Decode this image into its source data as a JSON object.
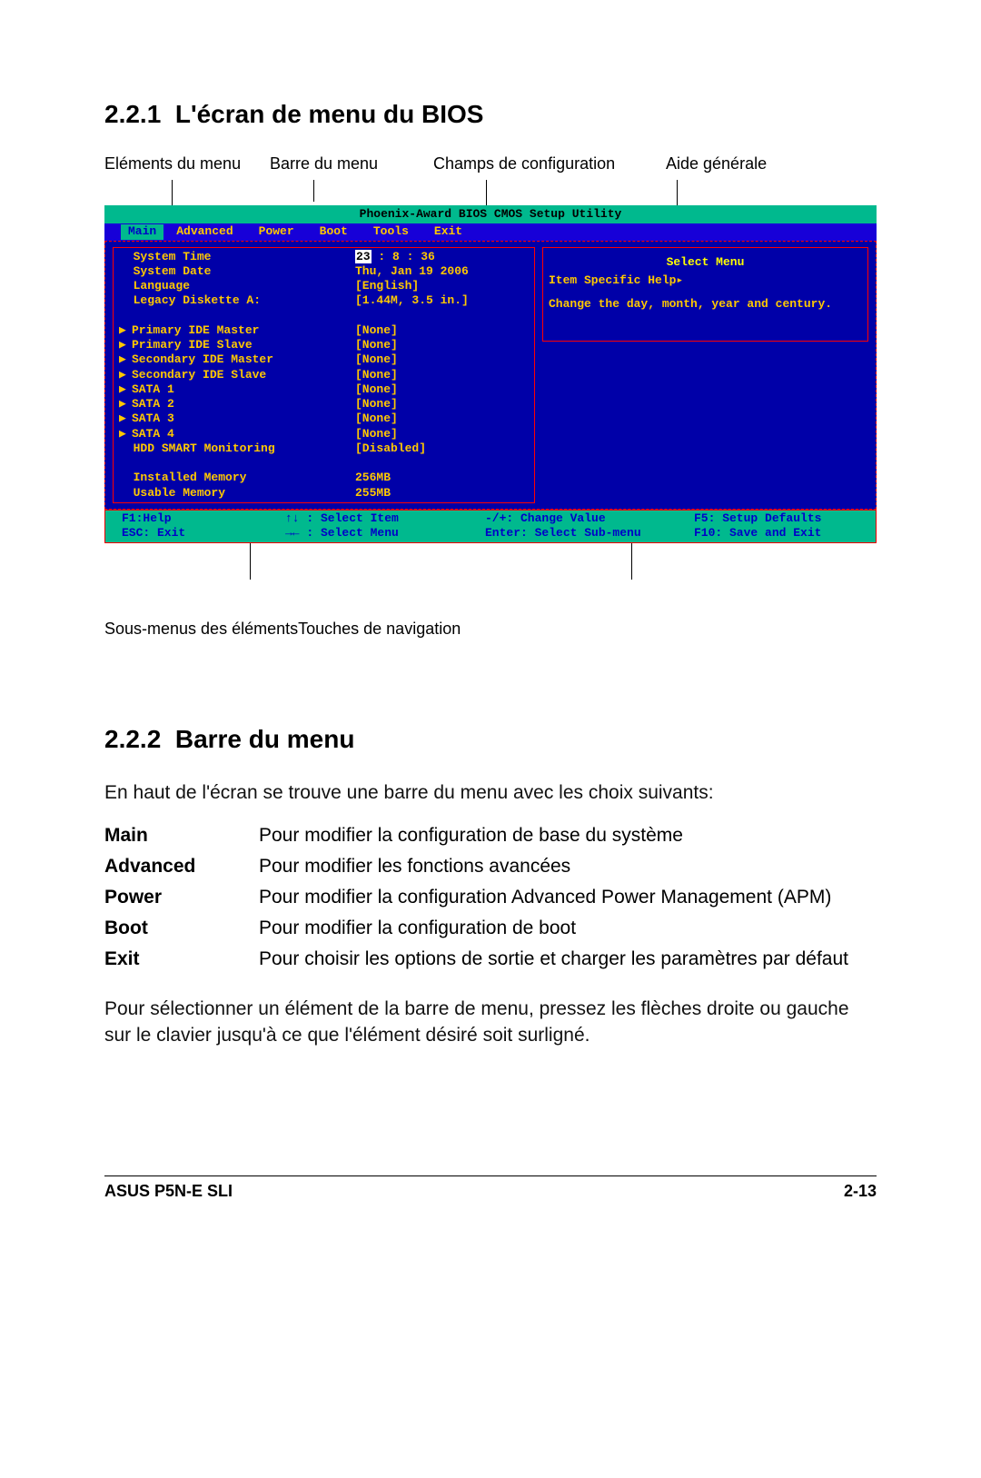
{
  "section1": {
    "number": "2.2.1",
    "title": "L'écran de menu du BIOS"
  },
  "annotations_top": {
    "a": "Eléments du menu",
    "b": "Barre du menu",
    "c": "Champs de configuration",
    "d": "Aide générale"
  },
  "bios": {
    "title": "Phoenix-Award BIOS CMOS Setup Utility",
    "menus": {
      "selected": "Main",
      "items": [
        "Advanced",
        "Power",
        "Boot",
        "Tools",
        "Exit"
      ]
    },
    "rows": [
      {
        "label": "System Time",
        "value": "23 : 8 : 36",
        "highlight_first": true
      },
      {
        "label": "System Date",
        "value": "Thu, Jan 19 2006"
      },
      {
        "label": "Language",
        "value": "[English]"
      },
      {
        "label": "Legacy Diskette A:",
        "value": "[1.44M, 3.5 in.]"
      },
      {
        "spacer": true
      },
      {
        "sub": true,
        "label": "Primary IDE Master",
        "value": "[None]"
      },
      {
        "sub": true,
        "label": "Primary IDE Slave",
        "value": "[None]"
      },
      {
        "sub": true,
        "label": "Secondary IDE Master",
        "value": "[None]"
      },
      {
        "sub": true,
        "label": "Secondary IDE Slave",
        "value": "[None]"
      },
      {
        "sub": true,
        "label": "SATA 1",
        "value": "[None]"
      },
      {
        "sub": true,
        "label": "SATA 2",
        "value": "[None]"
      },
      {
        "sub": true,
        "label": "SATA 3",
        "value": "[None]"
      },
      {
        "sub": true,
        "label": "SATA 4",
        "value": "[None]"
      },
      {
        "label": "HDD SMART Monitoring",
        "value": "[Disabled]",
        "indent": true
      },
      {
        "spacer": true
      },
      {
        "label": "Installed Memory",
        "value": "256MB",
        "indent": true
      },
      {
        "label": "Usable Memory",
        "value": "255MB",
        "indent": true
      }
    ],
    "help": {
      "header": "Select Menu",
      "subhead": "Item Specific Help▸",
      "body": "Change the day, month, year and century."
    },
    "footer": {
      "f1": "F1:Help",
      "arrows_ud": "↑↓ : Select Item",
      "pm": "-/+: Change Value",
      "f5": "F5: Setup Defaults",
      "esc": "ESC: Exit",
      "arrows_lr": "→← : Select Menu",
      "enter": "Enter: Select Sub-menu",
      "f10": "F10: Save and Exit"
    }
  },
  "annotations_bottom": {
    "left": "Sous-menus des éléments",
    "right": "Touches de navigation"
  },
  "section2": {
    "number": "2.2.2",
    "title": "Barre du menu",
    "intro": "En haut de l'écran se trouve une barre du menu avec les choix suivants:",
    "defs": [
      {
        "term": "Main",
        "desc": "Pour modifier la configuration de base du système"
      },
      {
        "term": "Advanced",
        "desc": "Pour modifier les fonctions avancées"
      },
      {
        "term": "Power",
        "desc": "Pour modifier la configuration Advanced Power Management (APM)"
      },
      {
        "term": "Boot",
        "desc": "Pour modifier la configuration de boot"
      },
      {
        "term": "Exit",
        "desc": "Pour choisir les options de sortie et charger les paramètres par défaut"
      }
    ],
    "outro": "Pour sélectionner un élément de la barre de menu, pressez les flèches droite ou gauche sur le clavier jusqu'à ce que l'élément désiré soit surligné."
  },
  "footer": {
    "left": "ASUS P5N-E SLI",
    "right": "2-13"
  }
}
